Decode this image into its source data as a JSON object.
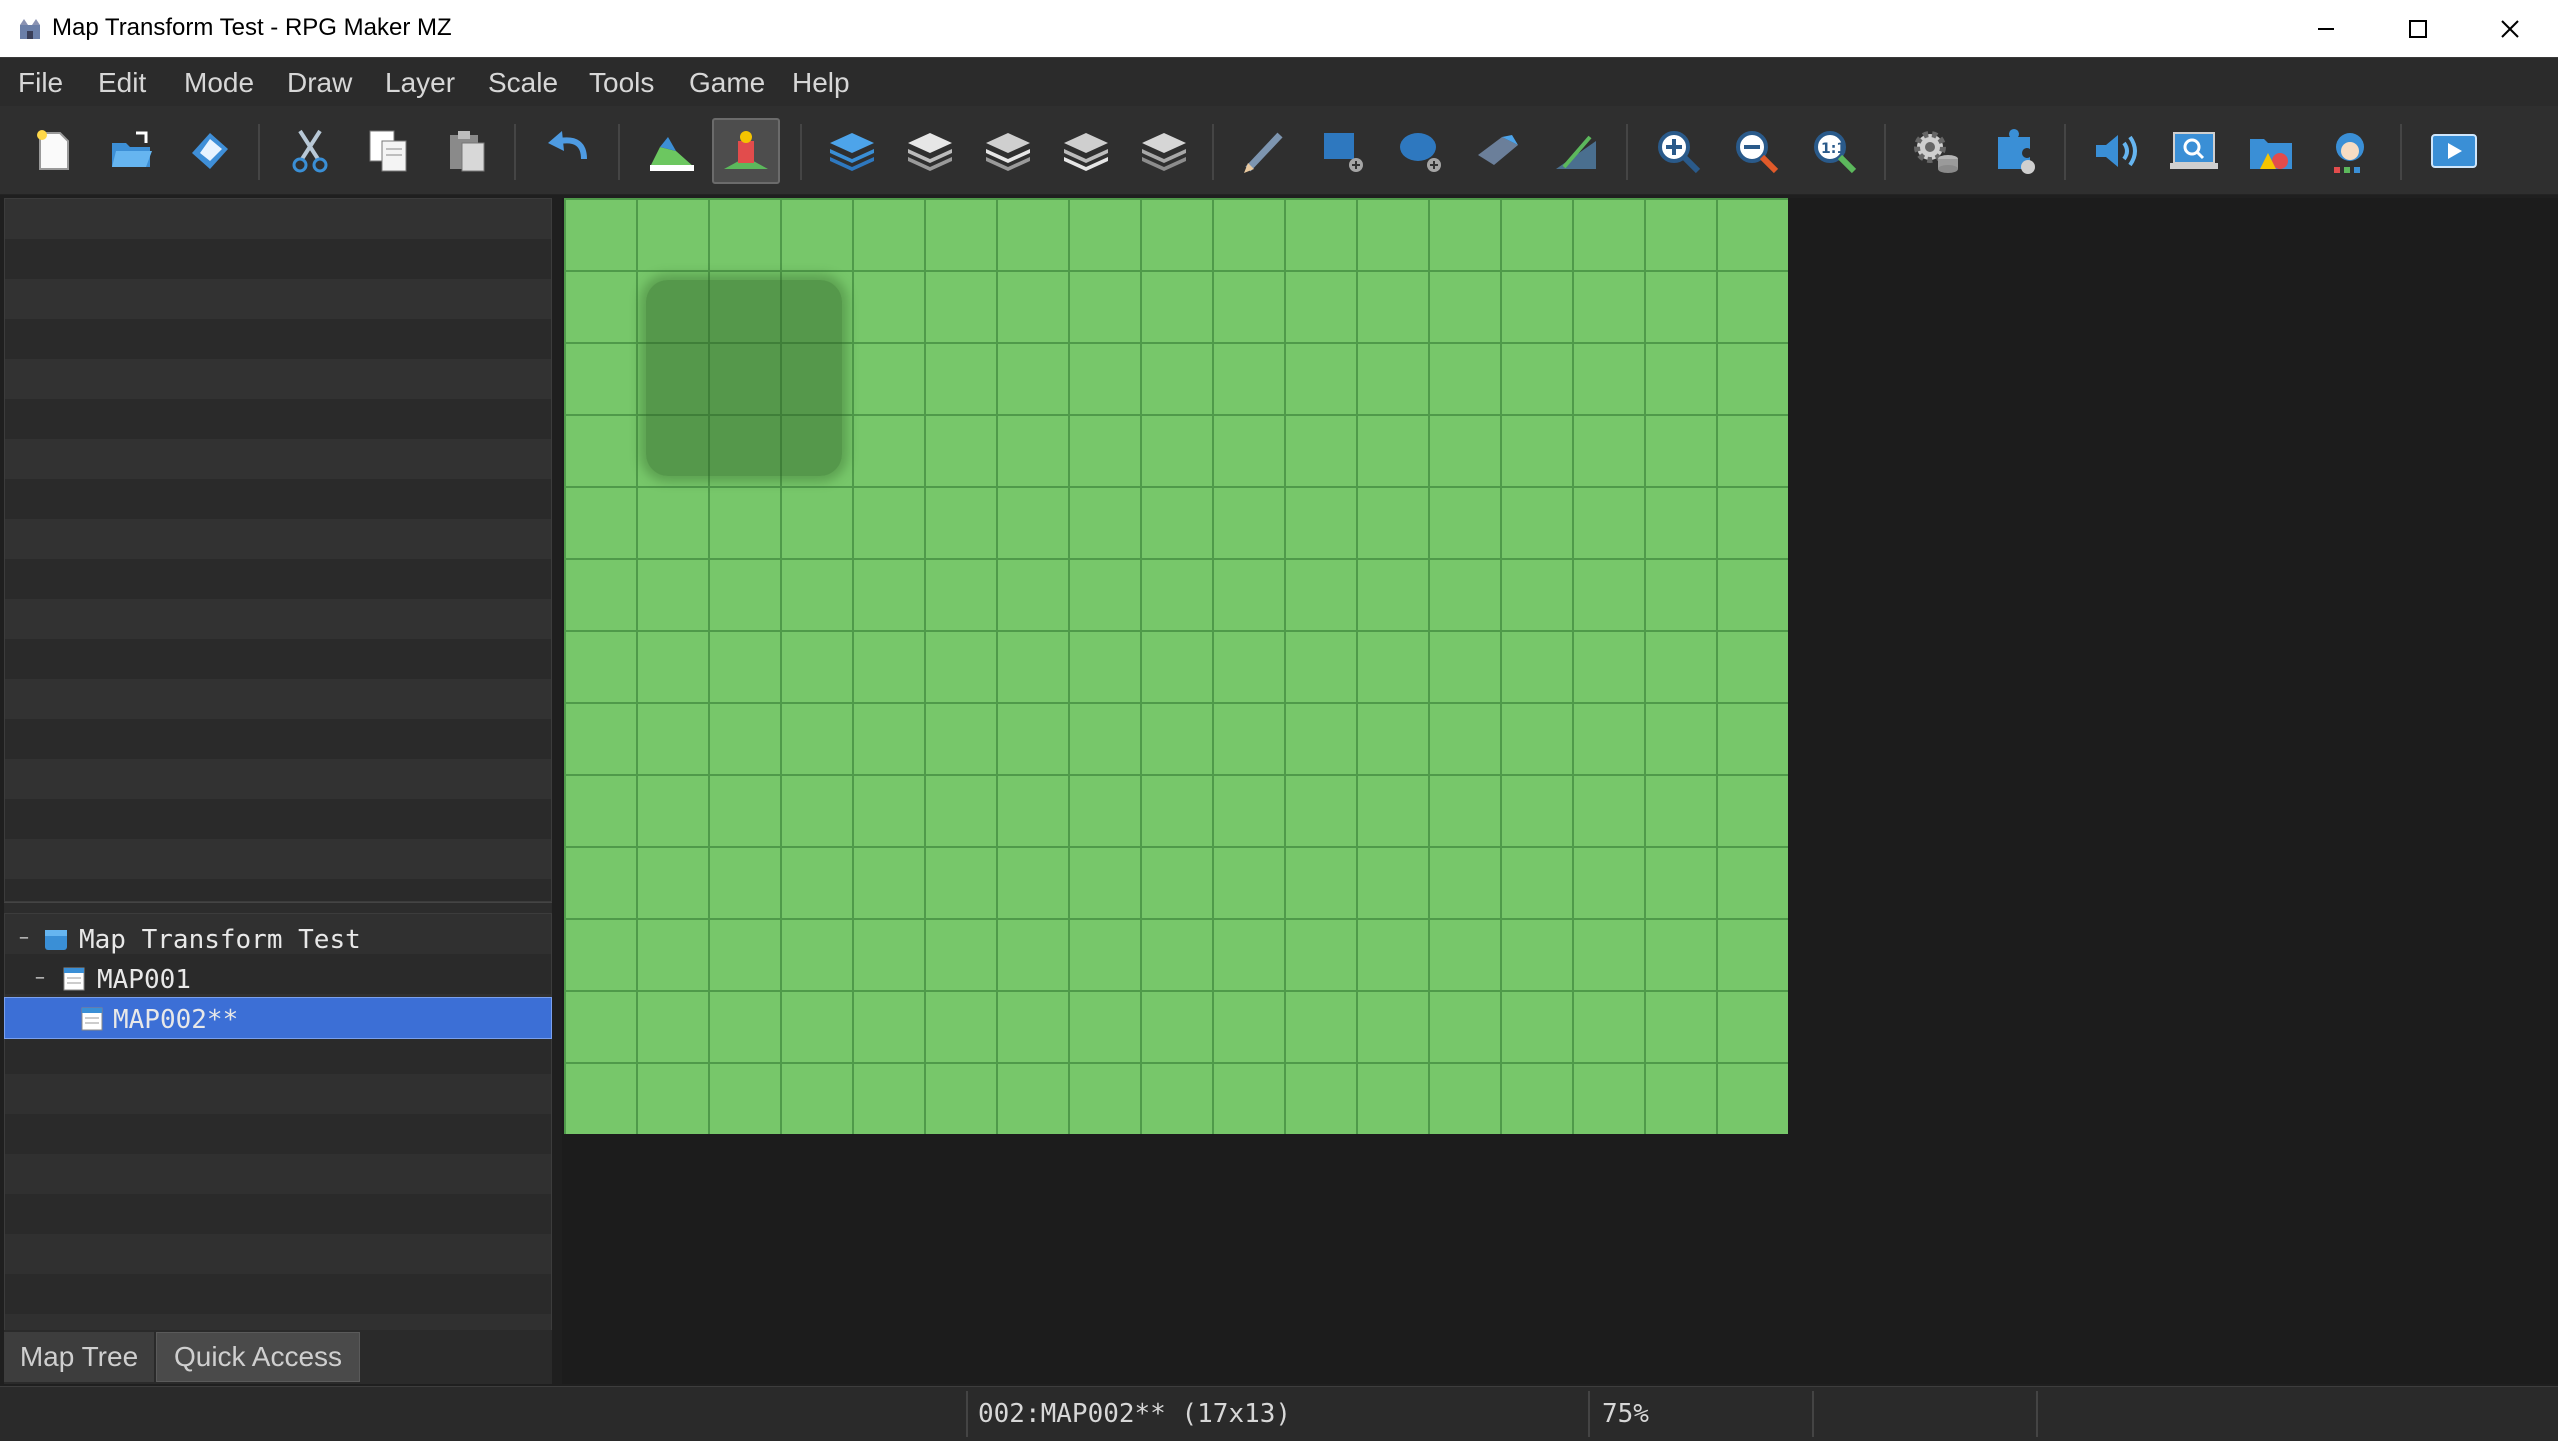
{
  "window": {
    "title": "Map Transform Test - RPG Maker MZ"
  },
  "menu": [
    "File",
    "Edit",
    "Mode",
    "Draw",
    "Layer",
    "Scale",
    "Tools",
    "Game",
    "Help"
  ],
  "toolbar": {
    "icons": [
      "new-project-icon",
      "open-project-icon",
      "save-project-icon",
      "cut-icon",
      "copy-icon",
      "paste-icon",
      "undo-icon",
      "map-mode-icon",
      "event-mode-icon",
      "layer-auto-icon",
      "layer-1-icon",
      "layer-2-icon",
      "layer-3-icon",
      "layer-4-icon",
      "pencil-icon",
      "rectangle-icon",
      "ellipse-icon",
      "flood-fill-icon",
      "shadow-pen-icon",
      "zoom-in-icon",
      "zoom-out-icon",
      "zoom-actual-icon",
      "database-icon",
      "plugin-manager-icon",
      "sound-test-icon",
      "event-searcher-icon",
      "resource-manager-icon",
      "character-generator-icon",
      "playtest-icon"
    ],
    "active": "event-mode-icon"
  },
  "map_tree": {
    "items": [
      {
        "label": "Map Transform Test",
        "depth": 0,
        "expanded": true,
        "selected": false,
        "icon": "project-icon"
      },
      {
        "label": "MAP001",
        "depth": 1,
        "expanded": true,
        "selected": false,
        "icon": "map-icon"
      },
      {
        "label": "MAP002**",
        "depth": 2,
        "expanded": false,
        "selected": true,
        "icon": "map-icon"
      }
    ]
  },
  "tabs": [
    "Map Tree",
    "Quick Access"
  ],
  "active_tab": "Map Tree",
  "map": {
    "columns": 17,
    "rows": 13,
    "tile": "grass",
    "colors": {
      "grass": "#77c76a",
      "grid": "#4f9a4a",
      "selection": "#3c6fd6"
    }
  },
  "status": {
    "map_info": "002:MAP002** (17x13)",
    "zoom": "75%"
  }
}
